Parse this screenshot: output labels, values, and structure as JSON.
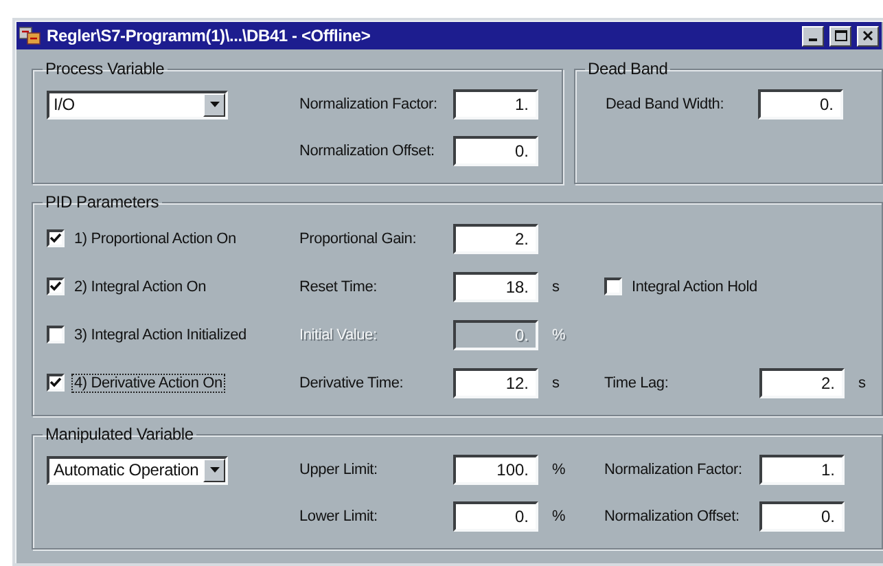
{
  "window": {
    "title": "Regler\\S7-Programm(1)\\...\\DB41 - <Offline>"
  },
  "process_variable": {
    "title": "Process Variable",
    "rows": [
      {
        "left": {
          "kind": "dropdown",
          "value": "I/O"
        },
        "middle": {
          "label": "Normalization Factor:",
          "value": "1."
        }
      },
      {
        "middle": {
          "label": "Normalization Offset:",
          "value": "0."
        }
      }
    ]
  },
  "dead_band": {
    "title": "Dead Band",
    "fields": [
      {
        "label": "Dead Band Width:",
        "value": "0."
      }
    ]
  },
  "pid_parameters": {
    "title": "PID Parameters",
    "rows": [
      {
        "left": {
          "kind": "checkbox",
          "label": "1) Proportional Action On",
          "checked": true,
          "focused": false
        },
        "middle": {
          "label": "Proportional Gain:",
          "value": "2.",
          "disabled": false
        }
      },
      {
        "left": {
          "kind": "checkbox",
          "label": "2) Integral Action On",
          "checked": true,
          "focused": false
        },
        "middle": {
          "label": "Reset Time:",
          "value": "18.",
          "unit": "s",
          "disabled": false
        },
        "right": {
          "kind": "checkbox",
          "label": "Integral Action Hold",
          "checked": false,
          "focused": false
        }
      },
      {
        "left": {
          "kind": "checkbox",
          "label": "3) Integral Action Initialized",
          "checked": false,
          "focused": false
        },
        "middle": {
          "label": "Initial Value:",
          "value": "0.",
          "unit": "%",
          "disabled": true
        }
      },
      {
        "left": {
          "kind": "checkbox",
          "label": "4) Derivative Action On",
          "checked": true,
          "focused": true
        },
        "middle": {
          "label": "Derivative Time:",
          "value": "12.",
          "unit": "s",
          "disabled": false
        },
        "right": {
          "kind": "field",
          "label": "Time Lag:",
          "value": "2.",
          "unit": "s"
        }
      }
    ]
  },
  "manipulated_variable": {
    "title": "Manipulated Variable",
    "rows": [
      {
        "left": {
          "kind": "dropdown",
          "value": "Automatic Operation"
        },
        "middle": {
          "label": "Upper Limit:",
          "value": "100.",
          "unit": "%"
        },
        "right": {
          "kind": "field",
          "label": "Normalization Factor:",
          "value": "1."
        }
      },
      {
        "middle": {
          "label": "Lower Limit:",
          "value": "0.",
          "unit": "%"
        },
        "right": {
          "kind": "field",
          "label": "Normalization Offset:",
          "value": "0."
        }
      }
    ]
  }
}
